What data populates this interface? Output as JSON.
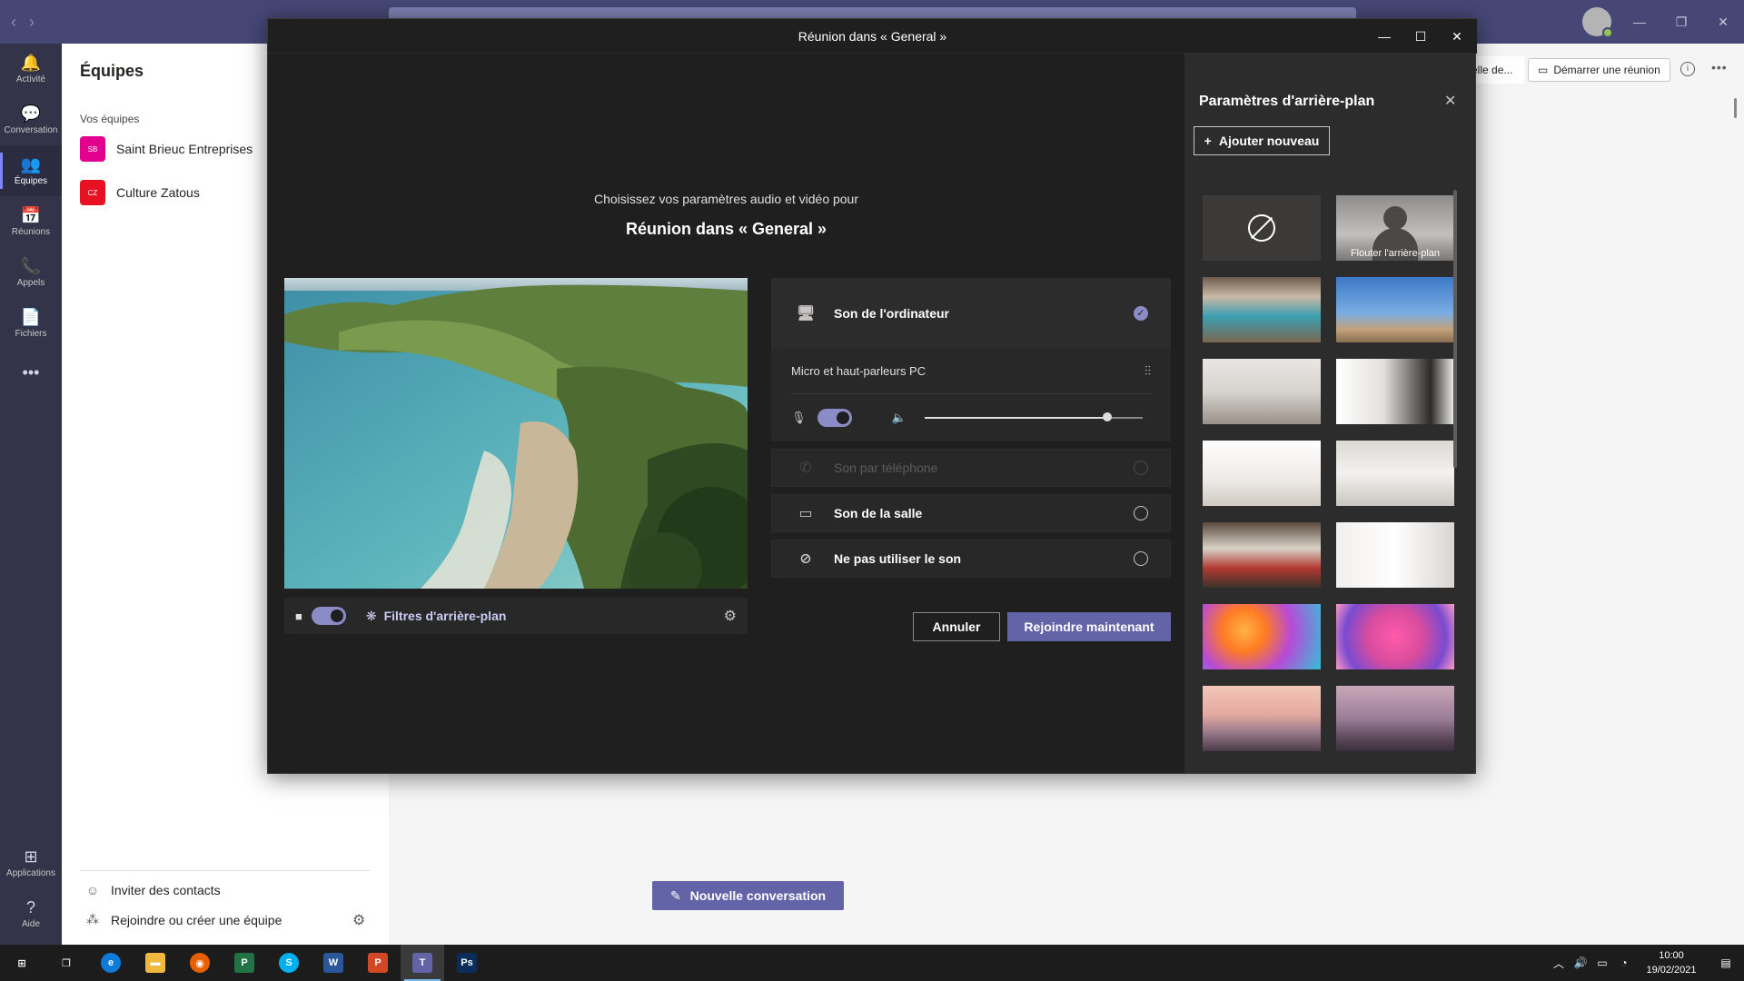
{
  "app": {
    "rail": [
      {
        "label": "Activité",
        "icon": "bell-icon",
        "glyph": "🔔"
      },
      {
        "label": "Conversation",
        "icon": "chat-icon",
        "glyph": "💬"
      },
      {
        "label": "Équipes",
        "icon": "teams-icon",
        "glyph": "👥"
      },
      {
        "label": "Réunions",
        "icon": "calendar-icon",
        "glyph": "📅"
      },
      {
        "label": "Appels",
        "icon": "phone-icon",
        "glyph": "📞"
      },
      {
        "label": "Fichiers",
        "icon": "file-icon",
        "glyph": "📄"
      },
      {
        "label": "",
        "icon": "more-icon",
        "glyph": "•••"
      },
      {
        "label": "Applications",
        "icon": "apps-icon",
        "glyph": "⊞"
      },
      {
        "label": "Aide",
        "icon": "help-icon",
        "glyph": "?"
      }
    ]
  },
  "teams_panel": {
    "title": "Équipes",
    "section_label": "Vos équipes",
    "teams": [
      {
        "initials": "SB",
        "name": "Saint Brieuc Entreprises",
        "color": "#e3008c"
      },
      {
        "initials": "CZ",
        "name": "Culture Zatous",
        "color": "#e81123"
      }
    ],
    "footer": {
      "invite_label": "Inviter des contacts",
      "join_label": "Rejoindre ou créer une équipe"
    }
  },
  "main": {
    "behind_tab_label": "elle de...",
    "start_meeting_label": "Démarrer une réunion",
    "new_conversation_label": "Nouvelle conversation"
  },
  "modal": {
    "title": "Réunion dans « General »",
    "pre_text": "Choisissez vos paramètres audio et vidéo pour",
    "meeting_name": "Réunion dans « General »",
    "video_bar": {
      "filters_label": "Filtres d'arrière-plan"
    },
    "audio": {
      "computer_label": "Son de l'ordinateur",
      "device_label": "Micro et haut-parleurs PC",
      "volume_level": 0.84,
      "phone_label": "Son par téléphone",
      "room_label": "Son de la salle",
      "none_label": "Ne pas utiliser le son"
    },
    "cancel_label": "Annuler",
    "join_label": "Rejoindre maintenant"
  },
  "bg_panel": {
    "title": "Paramètres d'arrière-plan",
    "add_label": "Ajouter nouveau",
    "blur_label": "Flouter l'arrière-plan",
    "thumbnails": [
      {
        "name": "bg-none"
      },
      {
        "name": "bg-blur"
      },
      {
        "name": "bg-office-lobby",
        "gradient": "linear-gradient(180deg,#6d5c4e 0%,#c9b9a6 30%,#3b9fb0 60%,#7b6651 100%)"
      },
      {
        "name": "bg-beach-city",
        "gradient": "linear-gradient(180deg,#3d79c7 0%,#79aee3 55%,#c4a27a 80%,#8a6e52 100%)"
      },
      {
        "name": "bg-white-room",
        "gradient": "linear-gradient(180deg,#e9e7e4 0%,#d7d3cf 50%,#9a928a 100%)"
      },
      {
        "name": "bg-white-hall",
        "gradient": "linear-gradient(90deg,#ffffff 0%,#e3e1de 40%,#2c2b2a 80%,#f0efec 100%)"
      },
      {
        "name": "bg-loft-white",
        "gradient": "linear-gradient(180deg,#ffffff 0%,#eeeae6 60%,#cfc9c2 100%)"
      },
      {
        "name": "bg-empty-room",
        "gradient": "linear-gradient(180deg,#dcd8d4 0%,#f4f2ef 50%,#c9c4bf 100%)"
      },
      {
        "name": "bg-cafeteria",
        "gradient": "linear-gradient(180deg,#5b4a3d 0%,#d8d2c8 40%,#b33a32 70%,#3c332c 100%)"
      },
      {
        "name": "bg-minimal-room",
        "gradient": "linear-gradient(90deg,#f1efec 0%,#ffffff 50%,#d9d6d2 100%)"
      },
      {
        "name": "bg-orange-spheres",
        "gradient": "radial-gradient(circle at 35% 40%,#ffb347 0%,#ff7b24 25%,#b74ad8 55%,#36c0d6 100%)"
      },
      {
        "name": "bg-pink-balls",
        "gradient": "radial-gradient(circle at 50% 50%,#ff5aa8 0%,#d94c9e 40%,#7a4bd1 75%,#ff9ac6 100%)"
      },
      {
        "name": "bg-bridge",
        "gradient": "linear-gradient(180deg,#f3c7b8 0%,#e3a8a0 45%,#9c7c8c 70%,#4a3b4a 100%)"
      },
      {
        "name": "bg-rock-arch",
        "gradient": "linear-gradient(180deg,#c7a7b8 0%,#9c7d99 50%,#5e4a5c 80%,#3a2e3c 100%)"
      }
    ]
  },
  "taskbar": {
    "apps": [
      {
        "name": "start-icon",
        "glyph": "⊞",
        "color": "transparent"
      },
      {
        "name": "task-view-icon",
        "glyph": "❐",
        "color": "transparent"
      },
      {
        "name": "edge-icon",
        "glyph": "e",
        "color": "#0f7ad8"
      },
      {
        "name": "explorer-icon",
        "glyph": "▬",
        "color": "#f0b83c"
      },
      {
        "name": "firefox-icon",
        "glyph": "◉",
        "color": "#e66000"
      },
      {
        "name": "project-icon",
        "glyph": "P",
        "color": "#217346"
      },
      {
        "name": "skype-icon",
        "glyph": "S",
        "color": "#00aff0"
      },
      {
        "name": "word-icon",
        "glyph": "W",
        "color": "#2b579a"
      },
      {
        "name": "powerpoint-icon",
        "glyph": "P",
        "color": "#d24726"
      },
      {
        "name": "teams-taskbar-icon",
        "glyph": "T",
        "color": "#6264a7"
      },
      {
        "name": "photoshop-icon",
        "glyph": "Ps",
        "color": "#0b2d59"
      }
    ],
    "time": "10:00",
    "date": "19/02/2021"
  }
}
